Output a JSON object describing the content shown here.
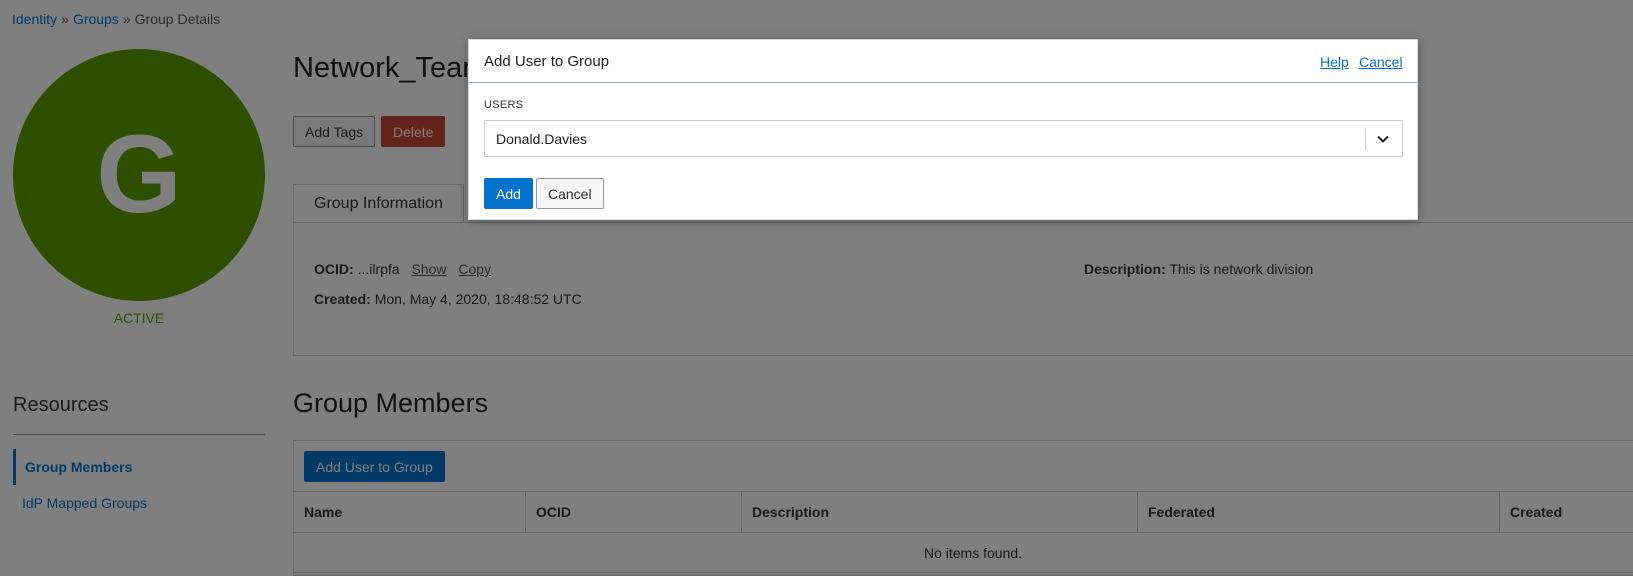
{
  "breadcrumb": {
    "identity": "Identity",
    "sep1": "»",
    "groups": "Groups",
    "sep2": "»",
    "current": "Group Details"
  },
  "avatar": {
    "letter": "G",
    "color": "#5f9e00"
  },
  "status": "ACTIVE",
  "page_title": "Network_Team",
  "actions": {
    "add_tags": "Add Tags",
    "delete": "Delete"
  },
  "tab": {
    "label": "Group Information"
  },
  "info": {
    "ocid_label": "OCID:",
    "ocid_value": "...ilrpfa",
    "show": "Show",
    "copy": "Copy",
    "created_label": "Created:",
    "created_value": "Mon, May 4, 2020, 18:48:52 UTC",
    "description_label": "Description:",
    "description_value": "This is network division"
  },
  "resources": {
    "title": "Resources",
    "items": [
      {
        "label": "Group Members",
        "active": true
      },
      {
        "label": "IdP Mapped Groups",
        "active": false
      }
    ]
  },
  "members": {
    "title": "Group Members",
    "add_button": "Add User to Group",
    "columns": [
      "Name",
      "OCID",
      "Description",
      "Federated",
      "Created"
    ],
    "empty_text": "No items found."
  },
  "modal": {
    "title": "Add User to Group",
    "help": "Help",
    "cancel_link": "Cancel",
    "users_label": "USERS",
    "selected_user": "Donald.Davies",
    "add_button": "Add",
    "cancel_button": "Cancel"
  },
  "colors": {
    "accent": "#0572ce",
    "danger": "#c74634",
    "active_green": "#5f9e00"
  }
}
